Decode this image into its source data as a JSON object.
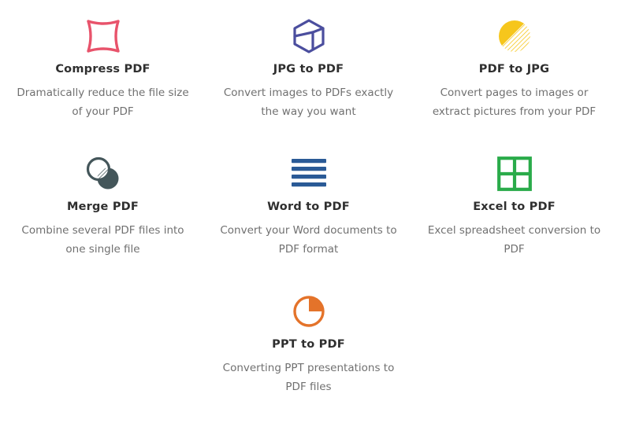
{
  "page": {
    "background_color": "#ffffff",
    "title_color": "#2f2f2f",
    "description_color": "#707070"
  },
  "tools": [
    {
      "id": "compress-pdf",
      "icon": "compress-square-icon",
      "icon_color": "#e8536b",
      "title": "Compress PDF",
      "description": "Dramatically reduce the file size of your PDF"
    },
    {
      "id": "jpg-to-pdf",
      "icon": "hexagon-cube-icon",
      "icon_color": "#4b4e9e",
      "title": "JPG to PDF",
      "description": "Convert images to PDFs exactly the way you want"
    },
    {
      "id": "pdf-to-jpg",
      "icon": "hatched-circle-icon",
      "icon_color": "#f6c61c",
      "title": "PDF to JPG",
      "description": "Convert pages to images or extract pictures from your PDF"
    },
    {
      "id": "merge-pdf",
      "icon": "overlapping-circles-icon",
      "icon_color": "#44565a",
      "title": "Merge PDF",
      "description": "Combine several PDF files into one single file"
    },
    {
      "id": "word-to-pdf",
      "icon": "text-lines-icon",
      "icon_color": "#2a5a96",
      "title": "Word to PDF",
      "description": "Convert your Word documents to PDF format"
    },
    {
      "id": "excel-to-pdf",
      "icon": "grid-cells-icon",
      "icon_color": "#2aab4a",
      "title": "Excel to PDF",
      "description": "Excel spreadsheet conversion to PDF"
    },
    {
      "id": "ppt-to-pdf",
      "icon": "pie-chart-icon",
      "icon_color": "#e4732a",
      "title": "PPT to PDF",
      "description": "Converting PPT presentations to PDF files"
    }
  ]
}
